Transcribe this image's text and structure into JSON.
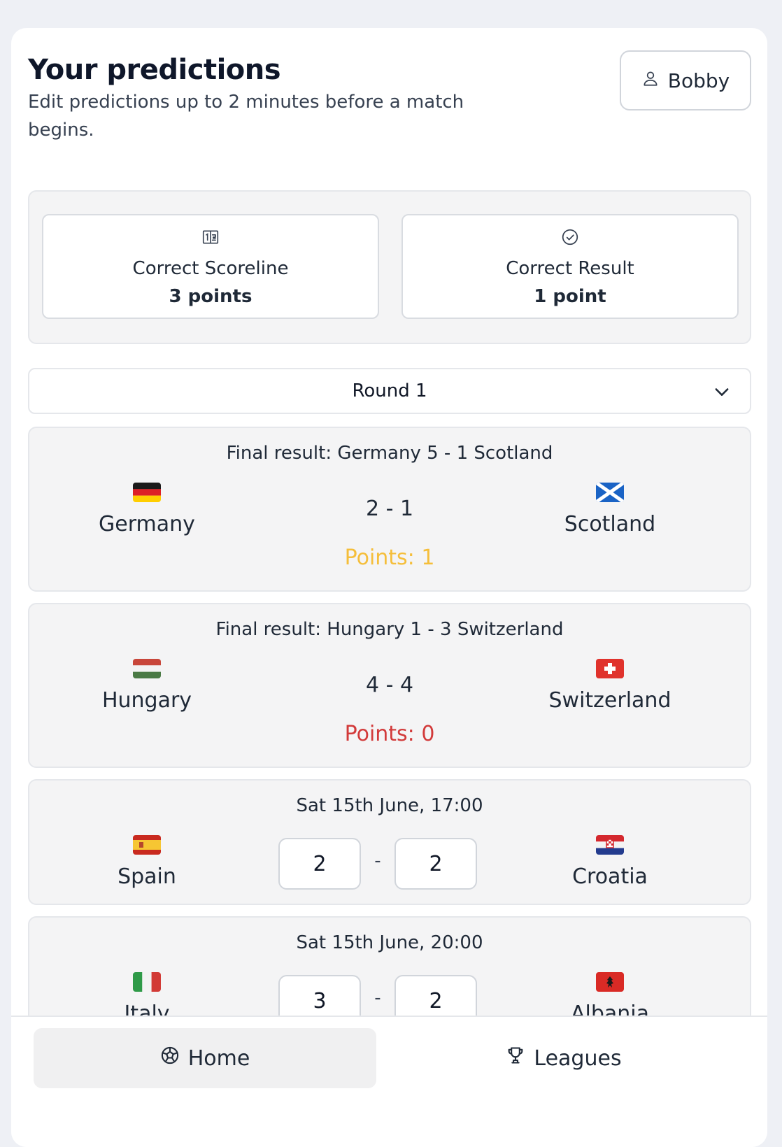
{
  "header": {
    "title": "Your predictions",
    "subtitle": "Edit predictions up to 2 minutes before a match begins.",
    "user_name": "Bobby"
  },
  "scoring": {
    "scoreline": {
      "label": "Correct Scoreline",
      "points": "3 points",
      "icon": "scoreboard-icon"
    },
    "result": {
      "label": "Correct Result",
      "points": "1 point",
      "icon": "check-circle-icon"
    }
  },
  "round_select": {
    "value": "Round 1"
  },
  "matches": [
    {
      "header": "Final result: Germany 5 - 1 Scotland",
      "home": {
        "name": "Germany",
        "flag": "germany-flag"
      },
      "away": {
        "name": "Scotland",
        "flag": "scotland-flag"
      },
      "prediction": "2 - 1",
      "points": "Points: 1",
      "points_color": "#f5be3a"
    },
    {
      "header": "Final result: Hungary 1 - 3 Switzerland",
      "home": {
        "name": "Hungary",
        "flag": "hungary-flag"
      },
      "away": {
        "name": "Switzerland",
        "flag": "switzerland-flag"
      },
      "prediction": "4 - 4",
      "points": "Points: 0",
      "points_color": "#d23a3a"
    },
    {
      "header": "Sat 15th June, 17:00",
      "home": {
        "name": "Spain",
        "flag": "spain-flag"
      },
      "away": {
        "name": "Croatia",
        "flag": "croatia-flag"
      },
      "home_score": "2",
      "away_score": "2",
      "separator": "-"
    },
    {
      "header": "Sat 15th June, 20:00",
      "home": {
        "name": "Italy",
        "flag": "italy-flag"
      },
      "away": {
        "name": "Albania",
        "flag": "albania-flag"
      },
      "home_score": "3",
      "away_score": "2",
      "separator": "-"
    }
  ],
  "nav": {
    "home_label": "Home",
    "leagues_label": "Leagues"
  }
}
